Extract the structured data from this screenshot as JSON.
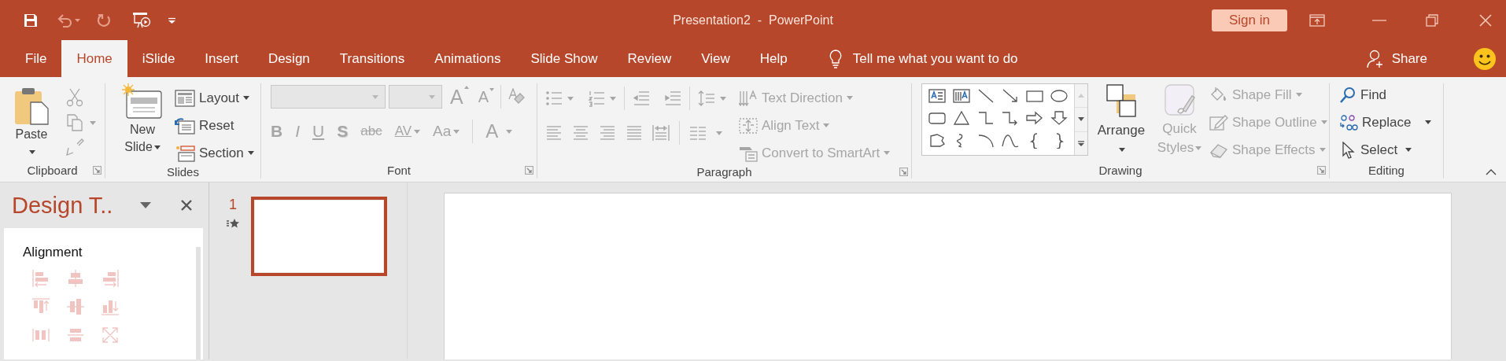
{
  "title_bar": {
    "title": "Presentation2  -  PowerPoint",
    "sign_in": "Sign in"
  },
  "tabs": [
    {
      "label": "File",
      "selected": false
    },
    {
      "label": "Home",
      "selected": true
    },
    {
      "label": "iSlide",
      "selected": false
    },
    {
      "label": "Insert",
      "selected": false
    },
    {
      "label": "Design",
      "selected": false
    },
    {
      "label": "Transitions",
      "selected": false
    },
    {
      "label": "Animations",
      "selected": false
    },
    {
      "label": "Slide Show",
      "selected": false
    },
    {
      "label": "Review",
      "selected": false
    },
    {
      "label": "View",
      "selected": false
    },
    {
      "label": "Help",
      "selected": false
    }
  ],
  "tell_me": "Tell me what you want to do",
  "share": "Share",
  "ribbon": {
    "clipboard": {
      "label": "Clipboard",
      "paste": "Paste"
    },
    "slides": {
      "label": "Slides",
      "new_slide": "New Slide",
      "commands": [
        {
          "label": "Layout",
          "dropdown": true
        },
        {
          "label": "Reset",
          "dropdown": false
        },
        {
          "label": "Section",
          "dropdown": true
        }
      ]
    },
    "font": {
      "label": "Font",
      "disabled": true,
      "grow": "A",
      "shrink": "A",
      "styles": [
        "B",
        "I",
        "U",
        "S",
        "abc",
        "AV",
        "Aa"
      ],
      "font_color": "A"
    },
    "paragraph": {
      "label": "Paragraph",
      "disabled": true,
      "commands": [
        {
          "label": "Text Direction"
        },
        {
          "label": "Align Text"
        },
        {
          "label": "Convert to SmartArt"
        }
      ]
    },
    "drawing": {
      "label": "Drawing",
      "arrange": "Arrange",
      "quick_styles": "Quick Styles",
      "quick_styles_disabled": true,
      "commands": [
        {
          "label": "Shape Fill",
          "disabled": true
        },
        {
          "label": "Shape Outline",
          "disabled": true
        },
        {
          "label": "Shape Effects",
          "disabled": true
        }
      ]
    },
    "editing": {
      "label": "Editing",
      "commands": [
        {
          "label": "Find",
          "dropdown": false
        },
        {
          "label": "Replace",
          "dropdown": true
        },
        {
          "label": "Select",
          "dropdown": true
        }
      ]
    }
  },
  "task_pane": {
    "title": "Design T..",
    "section": "Alignment"
  },
  "thumbnails": [
    {
      "number": "1",
      "selected": true
    }
  ]
}
